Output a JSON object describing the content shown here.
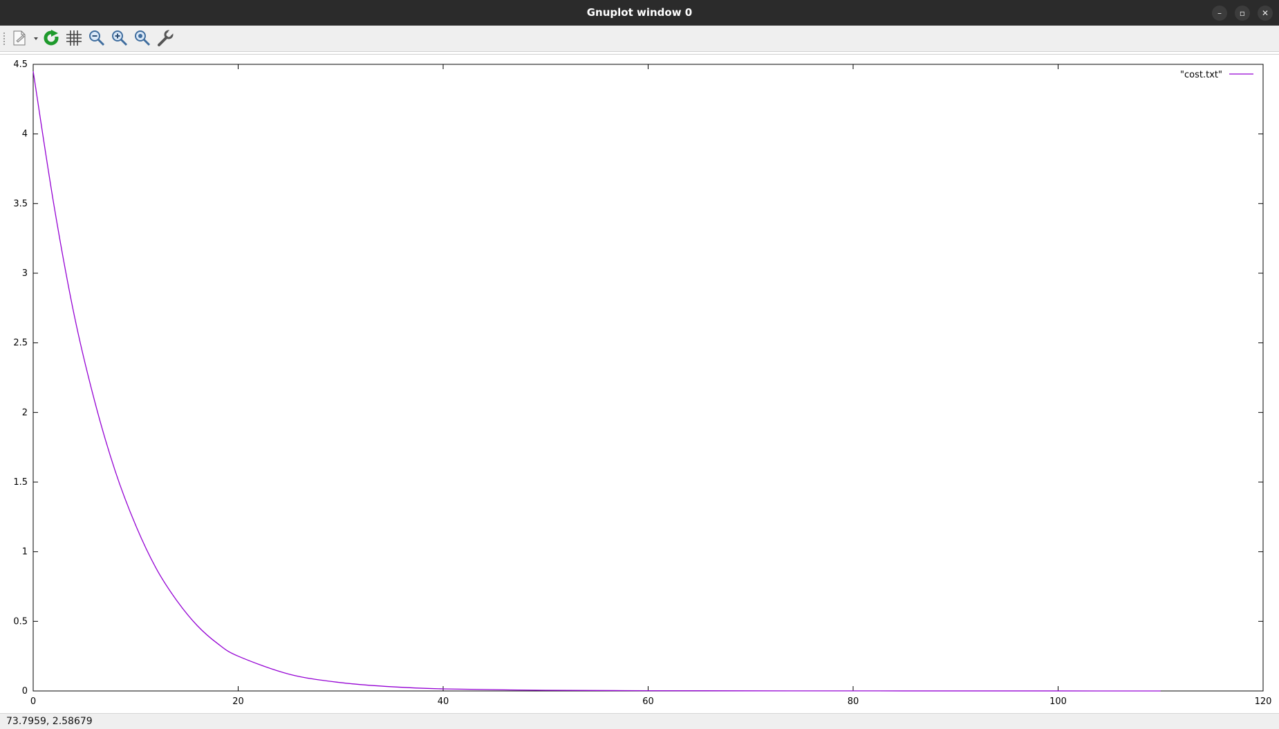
{
  "window": {
    "title": "Gnuplot window 0",
    "controls": {
      "minimize": "–",
      "restore": "▫",
      "close": "✕"
    }
  },
  "toolbar": {
    "items": [
      {
        "name": "copy-export-icon"
      },
      {
        "name": "replot-icon",
        "color": "#1e9a2c"
      },
      {
        "name": "grid-icon"
      },
      {
        "name": "zoom-previous-icon"
      },
      {
        "name": "zoom-next-icon"
      },
      {
        "name": "autoscale-icon"
      },
      {
        "name": "settings-wrench-icon"
      }
    ]
  },
  "status": {
    "coordinates": "73.7959,  2.58679"
  },
  "chart_data": {
    "type": "line",
    "title": "",
    "xlabel": "",
    "ylabel": "",
    "xlim": [
      0,
      120
    ],
    "ylim": [
      0,
      4.5
    ],
    "x_ticks": [
      "0",
      "20",
      "40",
      "60",
      "80",
      "100",
      "120"
    ],
    "y_ticks": [
      "0",
      "0.5",
      "1",
      "1.5",
      "2",
      "2.5",
      "3",
      "3.5",
      "4",
      "4.5"
    ],
    "grid": false,
    "legend": "top-right",
    "series": [
      {
        "name": "\"cost.txt\"",
        "color": "#9400d3",
        "x": [
          0,
          2,
          4,
          6,
          8,
          10,
          12,
          14,
          16,
          18,
          20,
          25,
          30,
          35,
          40,
          50,
          60,
          70,
          80,
          90,
          100,
          110
        ],
        "y": [
          4.45,
          3.5,
          2.7,
          2.08,
          1.58,
          1.19,
          0.88,
          0.65,
          0.47,
          0.34,
          0.25,
          0.12,
          0.06,
          0.03,
          0.015,
          0.005,
          0.002,
          0.001,
          0.0005,
          0.0003,
          0.0002,
          0.0001
        ]
      }
    ]
  }
}
